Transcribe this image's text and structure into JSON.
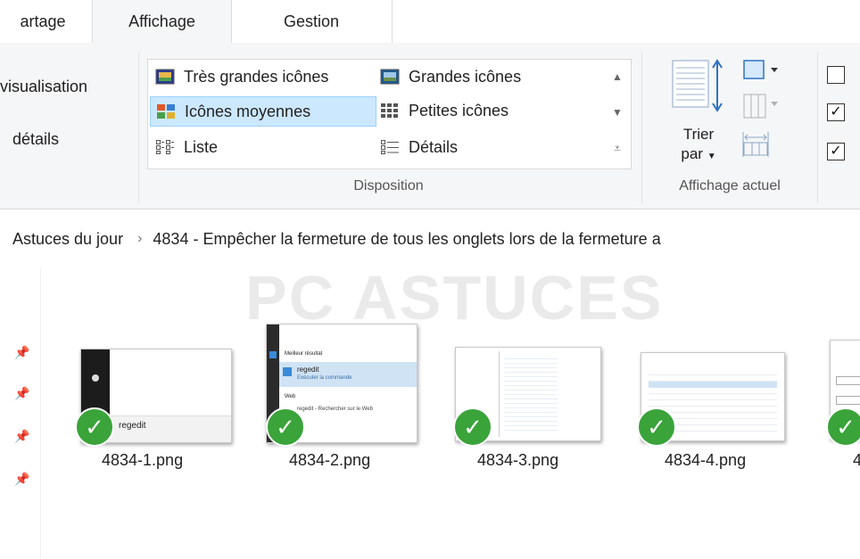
{
  "tabs": [
    {
      "label": "artage"
    },
    {
      "label": "Affichage"
    },
    {
      "label": "Gestion"
    }
  ],
  "panes": {
    "preview": "visualisation",
    "details": "détails"
  },
  "layout": {
    "items": [
      {
        "label": "Très grandes icônes"
      },
      {
        "label": "Grandes icônes"
      },
      {
        "label": "Icônes moyennes"
      },
      {
        "label": "Petites icônes"
      },
      {
        "label": "Liste"
      },
      {
        "label": "Détails"
      }
    ],
    "group_label": "Disposition"
  },
  "current_view": {
    "sort_label": "Trier",
    "sort_sub": "par",
    "group_label": "Affichage actuel"
  },
  "breadcrumb": {
    "parent": "Astuces du jour",
    "separator": "›",
    "current": "4834 - Empêcher la fermeture de tous les onglets lors de la fermeture a"
  },
  "watermark": "PC ASTUCES",
  "files": [
    {
      "name": "4834-1.png"
    },
    {
      "name": "4834-2.png"
    },
    {
      "name": "4834-3.png"
    },
    {
      "name": "4834-4.png"
    },
    {
      "name": "4"
    }
  ],
  "thumb_text": {
    "regedit": "regedit",
    "best_match": "Meilleur résultat",
    "run_cmd": "Exécuter la commande",
    "web": "Web",
    "web_search": "regedit - Rechercher sur le Web"
  }
}
